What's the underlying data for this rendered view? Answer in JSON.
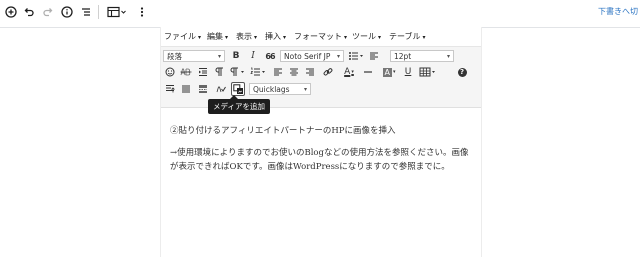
{
  "header": {
    "draft_save": "下書きへ切"
  },
  "menubar": {
    "items": [
      {
        "label": "ファイル"
      },
      {
        "label": "編集"
      },
      {
        "label": "表示"
      },
      {
        "label": "挿入"
      },
      {
        "label": "フォーマット"
      },
      {
        "label": "ツール"
      },
      {
        "label": "テーブル"
      }
    ]
  },
  "toolbar": {
    "paragraph_select": "段落",
    "font_select": "Noto Serif JP",
    "size_select": "12pt",
    "quicktags_select": "Quicklags",
    "bold": "B",
    "italic": "I",
    "quote": "66",
    "underline": "U",
    "text_color": "A",
    "bg_color": "A",
    "help": "?"
  },
  "tooltip": {
    "text": "メディアを追加"
  },
  "content": {
    "paragraphs": [
      "②貼り付けるアフィリエイトパートナーのHPに画像を挿入",
      "→使用環境によりますのでお使いのBlogなどの使用方法を参照ください。画像が表示できればOKです。画像はWordPressになりますので参照までに。"
    ]
  }
}
